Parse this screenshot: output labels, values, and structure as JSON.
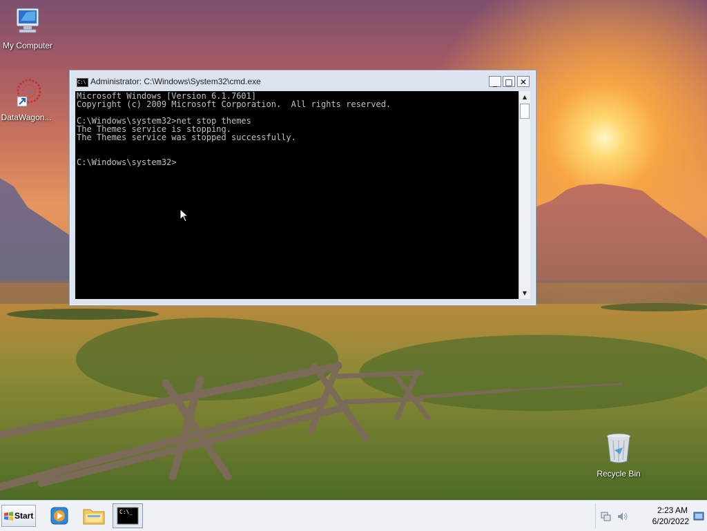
{
  "desktop": {
    "icons": [
      {
        "label": "My Computer",
        "icon": "computer-icon"
      },
      {
        "label": "DataWagon...",
        "icon": "shortcut-icon"
      },
      {
        "label": "Recycle Bin",
        "icon": "recycle-bin-icon"
      }
    ]
  },
  "cmd": {
    "title": "Administrator: C:\\Windows\\System32\\cmd.exe",
    "minimize": "_",
    "maximize": "□",
    "close": "✕",
    "lines": [
      "Microsoft Windows [Version 6.1.7601]",
      "Copyright (c) 2009 Microsoft Corporation.  All rights reserved.",
      "",
      "C:\\Windows\\system32>net stop themes",
      "The Themes service is stopping.",
      "The Themes service was stopped successfully.",
      "",
      "",
      "C:\\Windows\\system32>"
    ]
  },
  "taskbar": {
    "start_label": "Start",
    "apps": [
      {
        "name": "media-player",
        "icon": "media-player-icon"
      },
      {
        "name": "explorer",
        "icon": "folder-icon"
      },
      {
        "name": "cmd",
        "icon": "cmd-icon",
        "active": true
      }
    ],
    "clock": {
      "time": "2:23 AM",
      "date": "6/20/2022"
    }
  }
}
